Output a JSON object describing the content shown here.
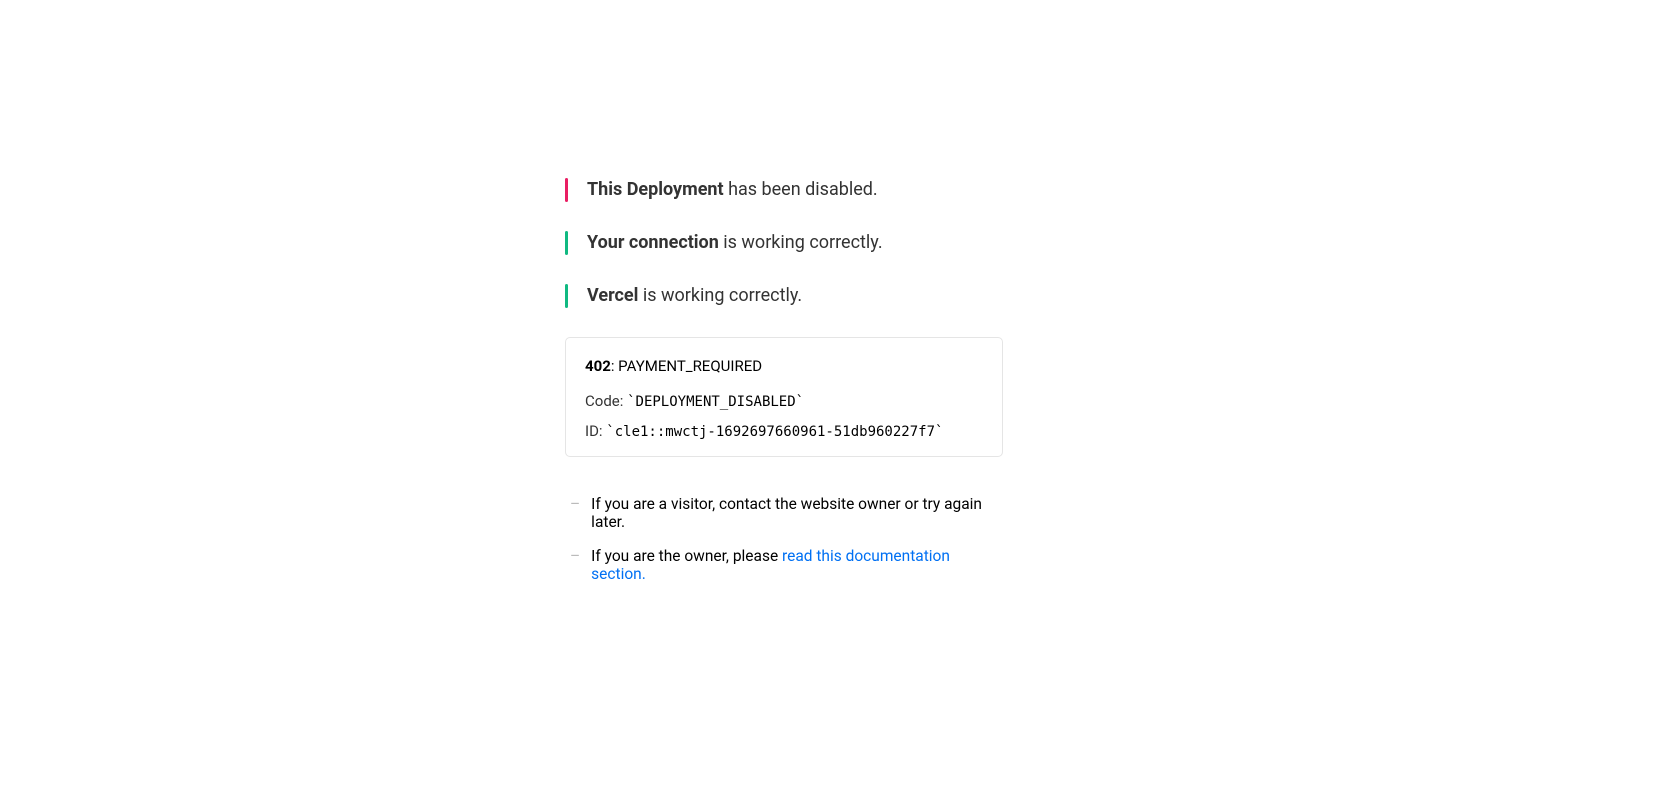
{
  "status": {
    "deployment": {
      "bold": "This Deployment",
      "rest": " has been disabled."
    },
    "connection": {
      "bold": "Your connection",
      "rest": " is working correctly."
    },
    "vercel": {
      "bold": "Vercel",
      "rest": " is working correctly."
    }
  },
  "details": {
    "http_code": "402",
    "http_message": ": PAYMENT_REQUIRED",
    "code_label": "Code: ",
    "code_value": "`DEPLOYMENT_DISABLED`",
    "id_label": "ID: ",
    "id_value": "`cle1::mwctj-1692697660961-51db960227f7`"
  },
  "help": {
    "visitor": "If you are a visitor, contact the website owner or try again later.",
    "owner_prefix": "If you are the owner, please ",
    "owner_link": "read this documentation section."
  }
}
